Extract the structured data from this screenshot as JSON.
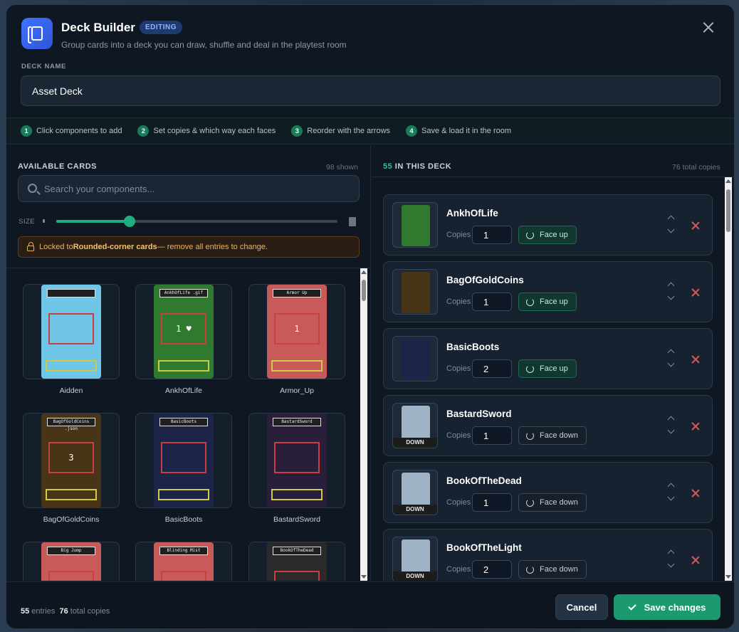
{
  "header": {
    "title": "Deck Builder",
    "badge": "EDITING",
    "subtitle": "Group cards into a deck you can draw, shuffle and deal in the playtest room"
  },
  "deck_name": {
    "label": "DECK NAME",
    "value": "Asset Deck"
  },
  "steps": [
    {
      "num": "1",
      "text": "Click components to add"
    },
    {
      "num": "2",
      "text": "Set copies & which way each faces"
    },
    {
      "num": "3",
      "text": "Reorder with the arrows"
    },
    {
      "num": "4",
      "text": "Save & load it in the room"
    }
  ],
  "available": {
    "title": "AVAILABLE CARDS",
    "shown": "98 shown",
    "search_placeholder": "Search your components...",
    "size_label": "SIZE",
    "size_value": 0.26,
    "lock_prefix": "Locked to ",
    "lock_bold": "Rounded-corner cards",
    "lock_suffix": " — remove all entries to change.",
    "cards": [
      {
        "name": "Aidden",
        "color": "#6fc6e6"
      },
      {
        "name": "AnkhOfLife",
        "color": "#2f7a2f",
        "label": "AnkhOfLife .gif",
        "stat": "1 ♥"
      },
      {
        "name": "Armor_Up",
        "color": "#c85a5a",
        "label": "Armor Up",
        "stat": "1"
      },
      {
        "name": "BagOfGoldCoins",
        "color": "#4a3418",
        "label": "BagOfGoldCoins .json",
        "stat": "3"
      },
      {
        "name": "BasicBoots",
        "color": "#1c2448",
        "label": "BasicBoots",
        "stat": ""
      },
      {
        "name": "BastardSword",
        "color": "#2a1f3a",
        "label": "BastardSword",
        "stat": ""
      },
      {
        "name": "",
        "color": "#c85a5a",
        "label": "Big Jump",
        "stat": ""
      },
      {
        "name": "",
        "color": "#c85a5a",
        "label": "Blinding Mist",
        "stat": ""
      },
      {
        "name": "",
        "color": "#2a2a2a",
        "label": "BookOfTheDead",
        "stat": ""
      }
    ]
  },
  "deck": {
    "count": "55",
    "title_suffix": " IN THIS DECK",
    "total_copies": "76 total copies",
    "copies_label": "Copies",
    "entries": [
      {
        "name": "AnkhOfLife",
        "copies": "1",
        "face": "Face up",
        "facing": "up",
        "color": "#2f7a2f",
        "down_tag": ""
      },
      {
        "name": "BagOfGoldCoins",
        "copies": "1",
        "face": "Face up",
        "facing": "up",
        "color": "#4a3418",
        "down_tag": ""
      },
      {
        "name": "BasicBoots",
        "copies": "2",
        "face": "Face up",
        "facing": "up",
        "color": "#1c2448",
        "down_tag": ""
      },
      {
        "name": "BastardSword",
        "copies": "1",
        "face": "Face down",
        "facing": "down",
        "color": "#9fb3c6",
        "down_tag": "DOWN"
      },
      {
        "name": "BookOfTheDead",
        "copies": "1",
        "face": "Face down",
        "facing": "down",
        "color": "#9fb3c6",
        "down_tag": "DOWN"
      },
      {
        "name": "BookOfTheLight",
        "copies": "2",
        "face": "Face down",
        "facing": "down",
        "color": "#9fb3c6",
        "down_tag": "DOWN"
      }
    ]
  },
  "footer": {
    "entries_count": "55",
    "entries_label": " entries",
    "copies_count": "76",
    "copies_label": " total copies",
    "cancel": "Cancel",
    "save": "Save changes"
  },
  "colors": {
    "accent": "#1b9a72",
    "brand": "#3f73ff",
    "warning": "#e8b45a",
    "danger": "#d65a5a"
  }
}
